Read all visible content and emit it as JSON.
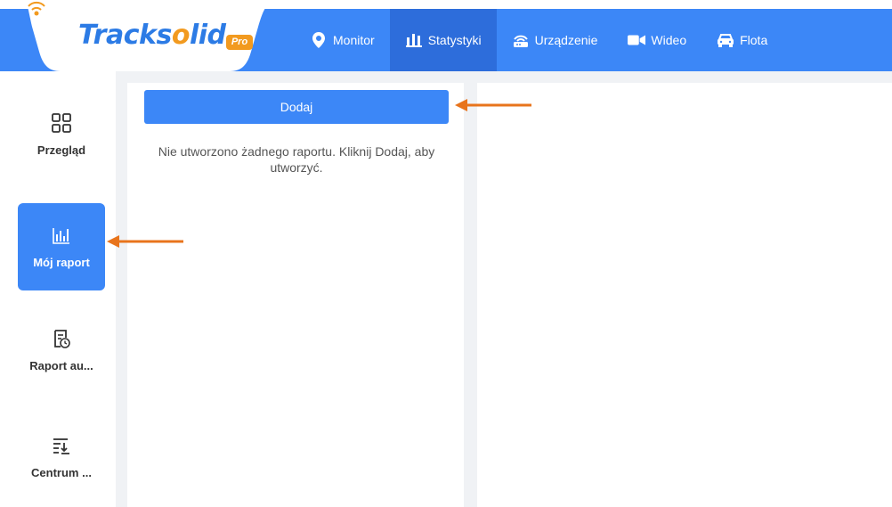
{
  "header": {
    "logo": {
      "text_main": "Tracks",
      "text_accent": "o",
      "text_tail": "lid",
      "badge": "Pro"
    },
    "nav": [
      {
        "label": "Monitor",
        "icon": "location-pin-icon",
        "active": false
      },
      {
        "label": "Statystyki",
        "icon": "bar-chart-icon",
        "active": true
      },
      {
        "label": "Urządzenie",
        "icon": "router-icon",
        "active": false
      },
      {
        "label": "Wideo",
        "icon": "video-camera-icon",
        "active": false
      },
      {
        "label": "Flota",
        "icon": "car-icon",
        "active": false
      }
    ]
  },
  "sidebar": {
    "items": [
      {
        "label": "Przegląd",
        "icon": "grid-icon",
        "active": false
      },
      {
        "label": "Mój raport",
        "icon": "bar-chart-icon",
        "active": true
      },
      {
        "label": "Raport au...",
        "icon": "scheduled-report-icon",
        "active": false
      },
      {
        "label": "Centrum ...",
        "icon": "download-list-icon",
        "active": false
      }
    ]
  },
  "report_list": {
    "add_label": "Dodaj",
    "empty_message": "Nie utworzono żadnego raportu. Kliknij Dodaj, aby utworzyć."
  },
  "colors": {
    "primary": "#3c87f7",
    "nav_active": "#2d6ddb",
    "annotation_arrow": "#e8741c"
  }
}
